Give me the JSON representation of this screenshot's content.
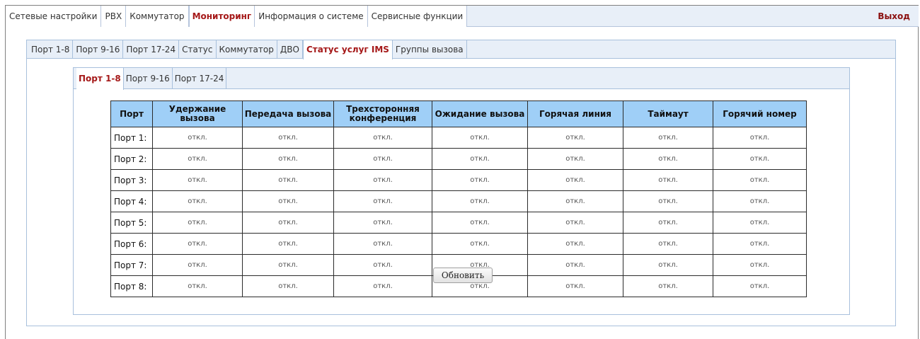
{
  "top_nav": {
    "tabs": [
      {
        "label": "Сетевые настройки"
      },
      {
        "label": "PBX"
      },
      {
        "label": "Коммутатор"
      },
      {
        "label": "Мониторинг",
        "active": true
      },
      {
        "label": "Информация о системе"
      },
      {
        "label": "Сервисные функции"
      }
    ],
    "logout": "Выход"
  },
  "sub_nav": {
    "tabs": [
      {
        "label": "Порт 1-8"
      },
      {
        "label": "Порт 9-16"
      },
      {
        "label": "Порт 17-24"
      },
      {
        "label": "Статус"
      },
      {
        "label": "Коммутатор"
      },
      {
        "label": "ДВО"
      },
      {
        "label": "Статус услуг IMS",
        "active": true
      },
      {
        "label": "Группы вызова"
      }
    ]
  },
  "port_nav": {
    "tabs": [
      {
        "label": "Порт 1-8",
        "active": true
      },
      {
        "label": "Порт 9-16"
      },
      {
        "label": "Порт 17-24"
      }
    ]
  },
  "table": {
    "headers": [
      "Порт",
      "Удержание вызова",
      "Передача вызова",
      "Трехсторонняя конференция",
      "Ожидание вызова",
      "Горячая линия",
      "Таймаут",
      "Горячий номер"
    ],
    "rows": [
      {
        "port": "Порт 1:",
        "values": [
          "откл.",
          "откл.",
          "откл.",
          "откл.",
          "откл.",
          "откл.",
          "откл."
        ]
      },
      {
        "port": "Порт 2:",
        "values": [
          "откл.",
          "откл.",
          "откл.",
          "откл.",
          "откл.",
          "откл.",
          "откл."
        ]
      },
      {
        "port": "Порт 3:",
        "values": [
          "откл.",
          "откл.",
          "откл.",
          "откл.",
          "откл.",
          "откл.",
          "откл."
        ]
      },
      {
        "port": "Порт 4:",
        "values": [
          "откл.",
          "откл.",
          "откл.",
          "откл.",
          "откл.",
          "откл.",
          "откл."
        ]
      },
      {
        "port": "Порт 5:",
        "values": [
          "откл.",
          "откл.",
          "откл.",
          "откл.",
          "откл.",
          "откл.",
          "откл."
        ]
      },
      {
        "port": "Порт 6:",
        "values": [
          "откл.",
          "откл.",
          "откл.",
          "откл.",
          "откл.",
          "откл.",
          "откл."
        ]
      },
      {
        "port": "Порт 7:",
        "values": [
          "откл.",
          "откл.",
          "откл.",
          "откл.",
          "откл.",
          "откл.",
          "откл."
        ]
      },
      {
        "port": "Порт 8:",
        "values": [
          "откл.",
          "откл.",
          "откл.",
          "откл.",
          "откл.",
          "откл.",
          "откл."
        ]
      }
    ]
  },
  "refresh_button": "Обновить"
}
